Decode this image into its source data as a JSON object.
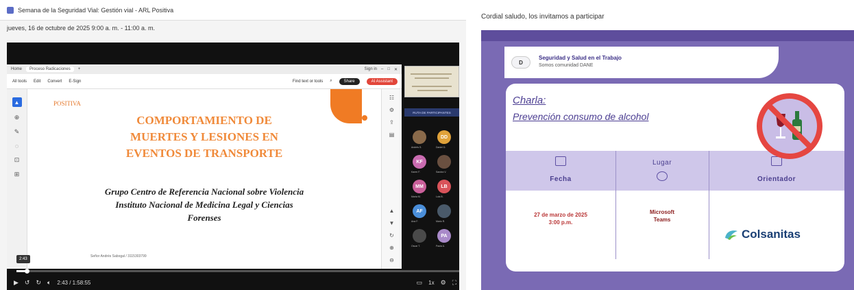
{
  "left": {
    "event_title": "Semana de la Seguridad Vial: Gestión vial - ARL Positiva",
    "event_time": "jueves, 16 de octubre de 2025 9:00 a. m. - 11:00 a. m.",
    "browser": {
      "home": "Home",
      "tab": "Proceso Radicaciones",
      "new_tab": "+",
      "sign_in": "Sign in"
    },
    "pdf_toolbar": {
      "all_tools": "All tools",
      "edit": "Edit",
      "convert": "Convert",
      "esign": "E-Sign",
      "find": "Find text or tools",
      "share": "Share",
      "ai": "AI Assistant"
    },
    "slide": {
      "logo": "POSITIVA",
      "title_lines": [
        "COMPORTAMIENTO DE",
        "MUERTES Y LESIONES EN",
        "EVENTOS DE TRANSPORTE"
      ],
      "subtitle_lines": [
        "Grupo Centro de Referencia Nacional sobre Violencia",
        "Instituto Nacional de Medicina Legal y Ciencias",
        "Forenses"
      ],
      "footer": "Señor Andrés Sabogal / 3115303799"
    },
    "participants_banner": "RUTA DE PARTICIPANTES",
    "participants": [
      {
        "initials": "",
        "color": "#8a6a4a",
        "name": "Andrés S."
      },
      {
        "initials": "DD",
        "color": "#e0a23a",
        "name": "Daniel D."
      },
      {
        "initials": "KF",
        "color": "#c96bb0",
        "name": "Karen F."
      },
      {
        "initials": "",
        "color": "#6a5040",
        "name": "Sandra V."
      },
      {
        "initials": "MM",
        "color": "#c9609a",
        "name": "María M."
      },
      {
        "initials": "LB",
        "color": "#d9535a",
        "name": "Luis B."
      },
      {
        "initials": "AF",
        "color": "#4a8ed9",
        "name": "Ana F."
      },
      {
        "initials": "",
        "color": "#4a5a6a",
        "name": "Mario R."
      },
      {
        "initials": "",
        "color": "#4a4a4a",
        "name": "Oscar T."
      },
      {
        "initials": "PA",
        "color": "#a98ac9",
        "name": "Paola A."
      }
    ],
    "player": {
      "current_badge": "2:43",
      "time_display": "2:43 / 1:58:55",
      "progress": 0.023,
      "speed": "1x"
    }
  },
  "right": {
    "greeting": "Cordial saludo, los invitamos a participar",
    "sst_logo": "D",
    "sst_title": "Seguridad y Salud en el Trabajo",
    "sst_sub": "Somos comunidad DANE",
    "charla_label": "Charla:",
    "charla_title": "Prevención consumo de  alcohol",
    "fecha_label": "Fecha",
    "lugar_label": "Lugar",
    "orientador_label": "Orientador",
    "fecha_value_1": "27 de marzo de 2025",
    "fecha_value_2": "3:00 p.m.",
    "lugar_value_1": "Microsoft",
    "lugar_value_2": "Teams",
    "orientador_value": "Colsanitas",
    "colors": {
      "purple": "#7a6ab4",
      "accent": "#4c3e92",
      "red": "#e54641",
      "orange": "#f08a3a"
    }
  }
}
